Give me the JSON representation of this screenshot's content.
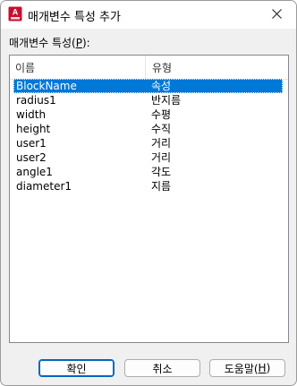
{
  "window": {
    "title": "매개변수 특성 추가",
    "app_icon": "autocad-a-icon",
    "close_icon": "close-x-icon"
  },
  "properties_label": {
    "prefix": "매개변수 특성(",
    "mnemonic": "P",
    "suffix": "):"
  },
  "table": {
    "columns": [
      "이름",
      "유형"
    ],
    "rows": [
      {
        "name": "BlockName",
        "type": "속성",
        "selected": true
      },
      {
        "name": "radius1",
        "type": "반지름",
        "selected": false
      },
      {
        "name": "width",
        "type": "수평",
        "selected": false
      },
      {
        "name": "height",
        "type": "수직",
        "selected": false
      },
      {
        "name": "user1",
        "type": "거리",
        "selected": false
      },
      {
        "name": "user2",
        "type": "거리",
        "selected": false
      },
      {
        "name": "angle1",
        "type": "각도",
        "selected": false
      },
      {
        "name": "diameter1",
        "type": "지름",
        "selected": false
      }
    ]
  },
  "buttons": {
    "ok": "확인",
    "cancel": "취소",
    "help_prefix": "도움말(",
    "help_mnemonic": "H",
    "help_suffix": ")"
  },
  "colors": {
    "selection": "#0078d7",
    "app_icon_red": "#c8102e",
    "primary_border": "#0067c0"
  }
}
